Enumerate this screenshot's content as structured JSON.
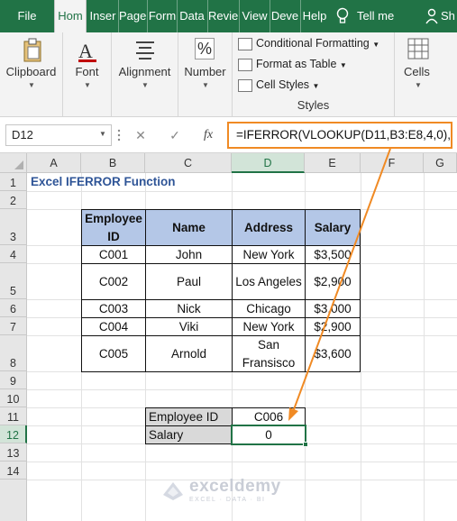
{
  "ribbon_tabs": [
    {
      "label": "File"
    },
    {
      "label": "Hom"
    },
    {
      "label": "Inser"
    },
    {
      "label": "Page"
    },
    {
      "label": "Form"
    },
    {
      "label": "Data"
    },
    {
      "label": "Revie"
    },
    {
      "label": "View"
    },
    {
      "label": "Deve"
    },
    {
      "label": "Help"
    },
    {
      "label": "Tell me"
    },
    {
      "label": "Sh"
    }
  ],
  "ribbon": {
    "clipboard": "Clipboard",
    "font": "Font",
    "alignment": "Alignment",
    "number": "Number",
    "conditional_formatting": "Conditional Formatting",
    "format_as_table": "Format as Table",
    "cell_styles": "Cell Styles",
    "styles": "Styles",
    "cells": "Cells"
  },
  "formula_bar": {
    "name_box": "D12",
    "fx": "fx",
    "formula": "=IFERROR(VLOOKUP(D11,B3:E8,4,0),0)"
  },
  "columns": [
    "A",
    "B",
    "C",
    "D",
    "E",
    "F",
    "G"
  ],
  "rows": [
    "1",
    "2",
    "3",
    "4",
    "5",
    "6",
    "7",
    "8",
    "9",
    "10",
    "11",
    "12",
    "13",
    "14"
  ],
  "sheet": {
    "title": "Excel IFERROR Function",
    "table_headers": [
      "Employee ID",
      "Name",
      "Address",
      "Salary"
    ],
    "table_rows": [
      [
        "C001",
        "John",
        "New York",
        "$3,500"
      ],
      [
        "C002",
        "Paul",
        "Los Angeles",
        "$2,900"
      ],
      [
        "C003",
        "Nick",
        "Chicago",
        "$3,000"
      ],
      [
        "C004",
        "Viki",
        "New York",
        "$2,900"
      ],
      [
        "C005",
        "Arnold",
        "San Fransisco",
        "$3,600"
      ]
    ],
    "lookup_label": "Employee ID",
    "lookup_value": "C006",
    "salary_label": "Salary",
    "salary_value": "0"
  },
  "watermark": {
    "name": "exceldemy",
    "tagline": "EXCEL · DATA · BI"
  },
  "colors": {
    "excel_green": "#217346",
    "header_fill": "#b4c7e7",
    "highlight": "#f08a24",
    "title_blue": "#2f5597"
  }
}
